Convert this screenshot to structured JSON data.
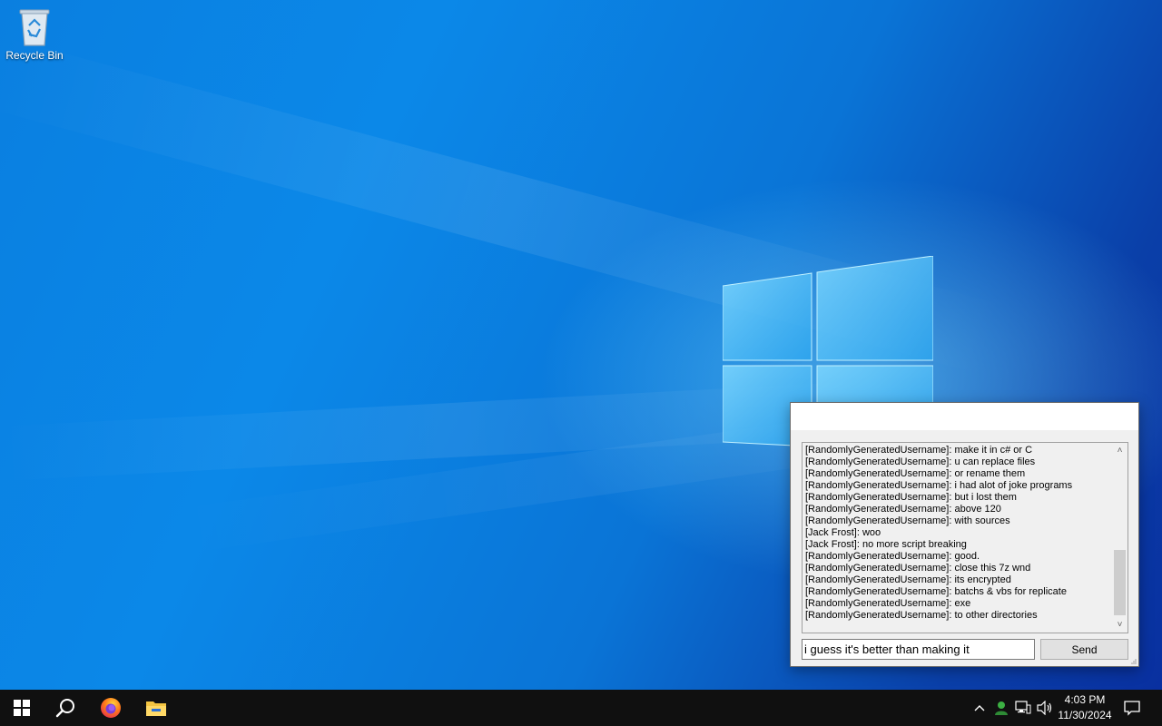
{
  "desktop": {
    "icons": [
      {
        "label": "Recycle Bin",
        "icon": "recycle-bin-icon"
      }
    ]
  },
  "chat_window": {
    "title": "",
    "messages": [
      "[RandomlyGeneratedUsername]: make it in c# or C",
      "[RandomlyGeneratedUsername]: u can replace files",
      "[RandomlyGeneratedUsername]: or rename them",
      "[RandomlyGeneratedUsername]: i had alot of joke programs",
      "[RandomlyGeneratedUsername]: but i lost them",
      "[RandomlyGeneratedUsername]: above 120",
      "[RandomlyGeneratedUsername]: with sources",
      "[Jack Frost]: woo",
      "[Jack Frost]: no more script breaking",
      "[RandomlyGeneratedUsername]: good.",
      "[RandomlyGeneratedUsername]: close this 7z wnd",
      "[RandomlyGeneratedUsername]: its encrypted",
      "[RandomlyGeneratedUsername]: batchs & vbs for replicate",
      "[RandomlyGeneratedUsername]: exe",
      "[RandomlyGeneratedUsername]: to other directories"
    ],
    "input_value": "i guess it's better than making it",
    "send_label": "Send"
  },
  "taskbar": {
    "pinned": [
      {
        "name": "start-button",
        "icon": "windows-logo-icon"
      },
      {
        "name": "search-button",
        "icon": "search-icon"
      },
      {
        "name": "firefox-button",
        "icon": "firefox-icon"
      },
      {
        "name": "file-explorer-button",
        "icon": "folder-icon"
      }
    ],
    "tray_icons": [
      "chevron-up-icon",
      "user-icon",
      "network-icon",
      "volume-icon"
    ],
    "clock": {
      "time": "4:03 PM",
      "date": "11/30/2024"
    },
    "notification_icon": "notification-icon"
  },
  "colors": {
    "desktop_blue": "#0a7fe0",
    "taskbar": "#101010",
    "window_face": "#f0f0f0"
  }
}
